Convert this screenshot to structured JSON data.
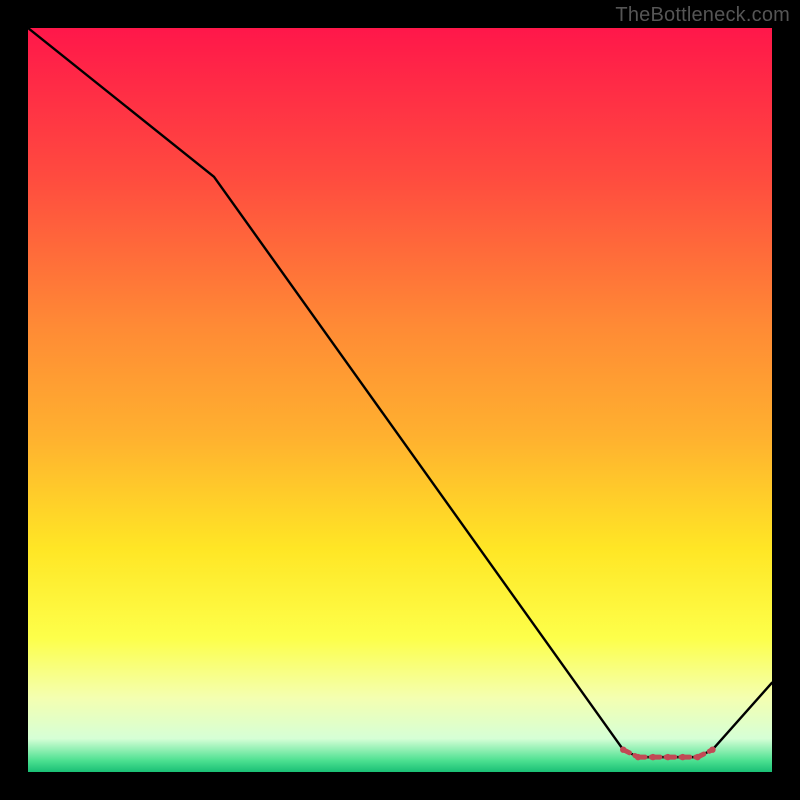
{
  "watermark": "TheBottleneck.com",
  "chart_data": {
    "type": "line",
    "title": "",
    "xlabel": "",
    "ylabel": "",
    "xlim": [
      0,
      100
    ],
    "ylim": [
      0,
      100
    ],
    "series": [
      {
        "name": "main-curve",
        "x": [
          0,
          25,
          80,
          82,
          84,
          86,
          88,
          90,
          92,
          100
        ],
        "values": [
          100,
          80,
          3,
          2,
          2,
          2,
          2,
          2,
          3,
          12
        ]
      }
    ],
    "markers": {
      "name": "dashed-segment",
      "x": [
        80,
        82,
        84,
        86,
        88,
        90,
        92
      ],
      "values": [
        3,
        2,
        2,
        2,
        2,
        2,
        3
      ],
      "color": "#c24a55"
    },
    "gradient_stops": [
      {
        "offset": 0.0,
        "color": "#ff174a"
      },
      {
        "offset": 0.2,
        "color": "#ff4b3f"
      },
      {
        "offset": 0.4,
        "color": "#ff8a35"
      },
      {
        "offset": 0.55,
        "color": "#ffb12f"
      },
      {
        "offset": 0.7,
        "color": "#ffe625"
      },
      {
        "offset": 0.82,
        "color": "#fdff4a"
      },
      {
        "offset": 0.9,
        "color": "#f4ffb0"
      },
      {
        "offset": 0.955,
        "color": "#d6ffd6"
      },
      {
        "offset": 0.985,
        "color": "#4be090"
      },
      {
        "offset": 1.0,
        "color": "#1abf75"
      }
    ]
  }
}
